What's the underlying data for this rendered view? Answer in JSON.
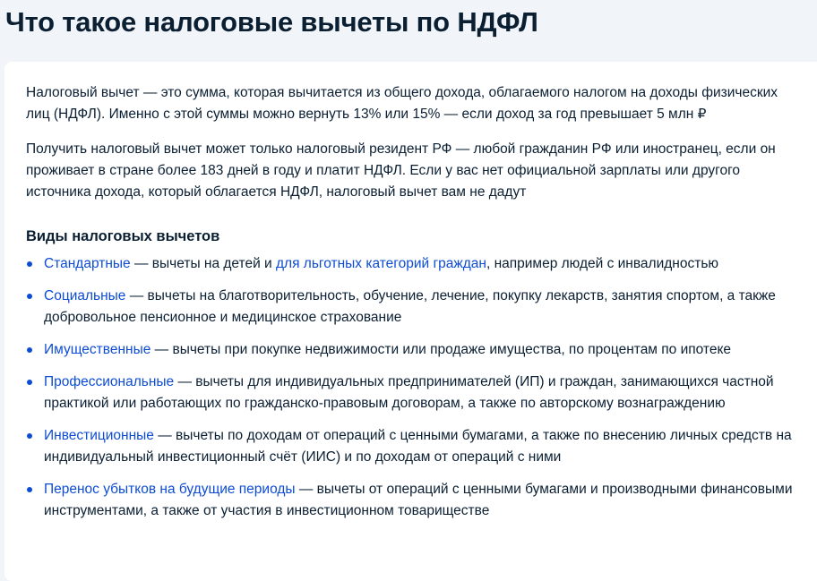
{
  "page": {
    "title": "Что такое налоговые вычеты по НДФЛ"
  },
  "intro": {
    "paragraph1": "Налоговый вычет — это сумма, которая вычитается из общего дохода, облагаемого налогом на доходы физических лиц (НДФЛ). Именно с этой суммы можно вернуть 13% или 15% — если доход за год превышает 5 млн ₽",
    "paragraph2": "Получить налоговый вычет может только налоговый резидент РФ — любой гражданин РФ или иностранец, если он проживает в стране более 183 дней в году и платит НДФЛ. Если у вас нет официальной зарплаты или другого источника дохода, который облагается НДФЛ, налоговый вычет вам не дадут"
  },
  "deductions": {
    "heading": "Виды налоговых вычетов",
    "items": [
      {
        "link": "Стандартные",
        "text": " — вычеты на детей и ",
        "link2": "для льготных категорий граждан",
        "text2": ", например людей с инвалидностью"
      },
      {
        "link": "Социальные",
        "text": " — вычеты на благотворительность, обучение, лечение, покупку лекарств, занятия спортом, а также добровольное пенсионное и медицинское страхование"
      },
      {
        "link": "Имущественные",
        "text": " — вычеты при покупке недвижимости или продаже имущества, по процентам по ипотеке"
      },
      {
        "link": "Профессиональные",
        "text": " — вычеты для индивидуальных предпринимателей (ИП) и граждан, занимающихся частной практикой или работающих по гражданско-правовым договорам, а также по авторскому вознаграждению"
      },
      {
        "link": "Инвестиционные",
        "text": " — вычеты по доходам от операций с ценными бумагами, а также по внесению личных средств на индивидуальный инвестиционный счёт (ИИС) и по доходам от операций с ними"
      },
      {
        "link": "Перенос убытков на будущие периоды",
        "text": " — вычеты от операций с ценными бумагами и производными финансовыми инструментами, а также от участия в инвестиционном товариществе"
      }
    ]
  },
  "colors": {
    "link": "#0d4cd3",
    "text": "#0b1f33",
    "background": "#f1f4f9",
    "card": "#ffffff"
  }
}
